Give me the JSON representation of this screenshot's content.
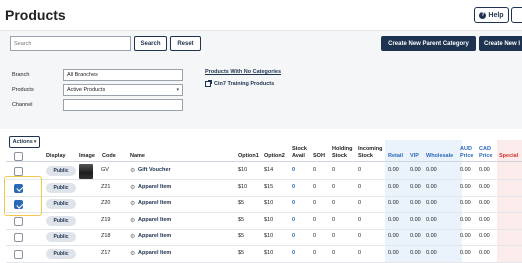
{
  "header": {
    "title": "Products",
    "help_label": "Help"
  },
  "filters": {
    "search_placeholder": "Search",
    "search_button": "Search",
    "reset_button": "Reset",
    "new_parent_category": "Create New Parent Category",
    "new_product_truncated": "Create New I",
    "branch_label": "Branch",
    "branch_value": "All Branches",
    "products_label": "Products",
    "products_value": "Active Products",
    "channel_label": "Channel",
    "channel_value": "",
    "link_no_categories": "Products With No Categories",
    "link_training": "Cin7 Training Products"
  },
  "table": {
    "actions_label": "Actions",
    "columns": {
      "display": "Display",
      "image": "Image",
      "code": "Code",
      "name": "Name",
      "option1": "Option1",
      "option2": "Option2",
      "stock_avail_1": "Stock",
      "stock_avail_2": "Avail",
      "soh": "SOH",
      "holding_1": "Holding",
      "holding_2": "Stock",
      "incoming_1": "Incoming",
      "incoming_2": "Stock",
      "retail": "Retail",
      "vip": "VIP",
      "wholesale": "Wholesale",
      "aud_1": "AUD",
      "aud_2": "Price",
      "cad_1": "CAD",
      "cad_2": "Price",
      "special": "Special"
    },
    "rows": [
      {
        "checked": false,
        "display": "Public",
        "image": true,
        "code": "GV",
        "name": "Gift Voucher",
        "option1": "$10",
        "option2": "$14",
        "stock": "0",
        "soh": "0",
        "holding": "0",
        "incoming": "0",
        "retail": "0.00",
        "vip": "0.00",
        "wholesale": "0.00",
        "aud": "0.00",
        "cad": "0.00"
      },
      {
        "checked": true,
        "display": "Public",
        "image": false,
        "code": "Z21",
        "name": "Apparel Item",
        "option1": "$10",
        "option2": "$15",
        "stock": "0",
        "soh": "0",
        "holding": "0",
        "incoming": "0",
        "retail": "0.00",
        "vip": "0.00",
        "wholesale": "0.00",
        "aud": "0.00",
        "cad": "0.00"
      },
      {
        "checked": true,
        "display": "Public",
        "image": false,
        "code": "Z20",
        "name": "Apparel Item",
        "option1": "$5",
        "option2": "$10",
        "stock": "0",
        "soh": "0",
        "holding": "0",
        "incoming": "0",
        "retail": "0.00",
        "vip": "0.00",
        "wholesale": "0.00",
        "aud": "0.00",
        "cad": "0.00"
      },
      {
        "checked": false,
        "display": "Public",
        "image": false,
        "code": "Z19",
        "name": "Apparel Item",
        "option1": "$5",
        "option2": "$10",
        "stock": "0",
        "soh": "0",
        "holding": "0",
        "incoming": "0",
        "retail": "0.00",
        "vip": "0.00",
        "wholesale": "0.00",
        "aud": "0.00",
        "cad": "0.00"
      },
      {
        "checked": false,
        "display": "Public",
        "image": false,
        "code": "Z18",
        "name": "Apparel Item",
        "option1": "$5",
        "option2": "$10",
        "stock": "0",
        "soh": "0",
        "holding": "0",
        "incoming": "0",
        "retail": "0.00",
        "vip": "0.00",
        "wholesale": "0.00",
        "aud": "0.00",
        "cad": "0.00"
      },
      {
        "checked": false,
        "display": "Public",
        "image": false,
        "code": "Z17",
        "name": "Apparel Item",
        "option1": "$5",
        "option2": "$10",
        "stock": "0",
        "soh": "0",
        "holding": "0",
        "incoming": "0",
        "retail": "0.00",
        "vip": "0.00",
        "wholesale": "0.00",
        "aud": "0.00",
        "cad": "0.00"
      }
    ]
  },
  "colors": {
    "brand_navy": "#1e3350",
    "price_blue": "#2b69b8",
    "special_red": "#d0342c",
    "highlight_yellow": "#f2c94c"
  }
}
